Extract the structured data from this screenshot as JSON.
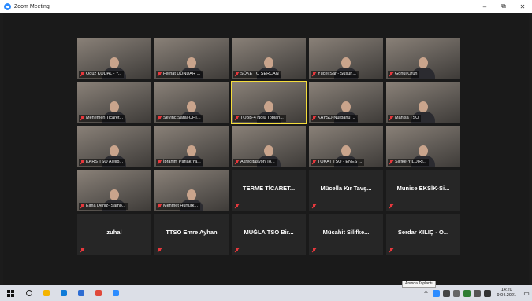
{
  "window": {
    "title": "Zoom Meeting",
    "controls": [
      "–",
      "⧉",
      "✕"
    ]
  },
  "participants": [
    {
      "name": "Oğuz KODAL - Y...",
      "video": true
    },
    {
      "name": "Ferhat DÜNDAR ...",
      "video": true
    },
    {
      "name": "SÖKE TO SERCAN",
      "video": true
    },
    {
      "name": "Yücel Sarı- Susurl...",
      "video": true
    },
    {
      "name": "Gönül Orun",
      "video": true
    },
    {
      "name": "Menemen Ticaret...",
      "video": true
    },
    {
      "name": "Şevinç Saral-OFT...",
      "video": true
    },
    {
      "name": "TOBB-4 Nolu Toplan...",
      "video": true,
      "active": true
    },
    {
      "name": "KAYSO-Nurbanu ...",
      "video": true
    },
    {
      "name": "Manisa TSO",
      "video": true
    },
    {
      "name": "KARS TSO Alelib...",
      "video": true
    },
    {
      "name": "İbrahim Parlak Ya...",
      "video": true
    },
    {
      "name": "Akreditasyon To...",
      "video": true
    },
    {
      "name": "TOKAT TSO - ENES ...",
      "video": true
    },
    {
      "name": "Silifke-YILDIRI...",
      "video": true
    },
    {
      "name": "Elma Deniz- Samo...",
      "video": true
    },
    {
      "name": "Mehmet Hurturk...",
      "video": true
    },
    {
      "name": "TERME TİCARET...",
      "video": false
    },
    {
      "name": "Mücella Kır Tavş...",
      "video": false
    },
    {
      "name": "Munise EKSİK-Si...",
      "video": false
    },
    {
      "name": "zuhal",
      "video": false
    },
    {
      "name": "TTSO Emre Ayhan",
      "video": false
    },
    {
      "name": "MUĞLA TSO Bir...",
      "video": false
    },
    {
      "name": "Mücahit Silifke...",
      "video": false
    },
    {
      "name": "Serdar KILIÇ - O...",
      "video": false
    }
  ],
  "taskbar": {
    "tooltip": "Anında Toplantı",
    "time": "14:20",
    "date": "9.04.2021",
    "apps": [
      {
        "name": "search-icon",
        "color": "#222222"
      },
      {
        "name": "file-explorer-icon",
        "color": "#f4b400"
      },
      {
        "name": "edge-icon",
        "color": "#0f7bd8"
      },
      {
        "name": "mail-icon",
        "color": "#2d6cd2"
      },
      {
        "name": "chrome-icon",
        "color": "#e0493b"
      },
      {
        "name": "zoom-icon",
        "color": "#2d8cff"
      }
    ]
  },
  "colors": {
    "active_border": "#f5dd3c",
    "muted_mic": "#e8383d",
    "zoom_blue": "#2d8cff"
  }
}
